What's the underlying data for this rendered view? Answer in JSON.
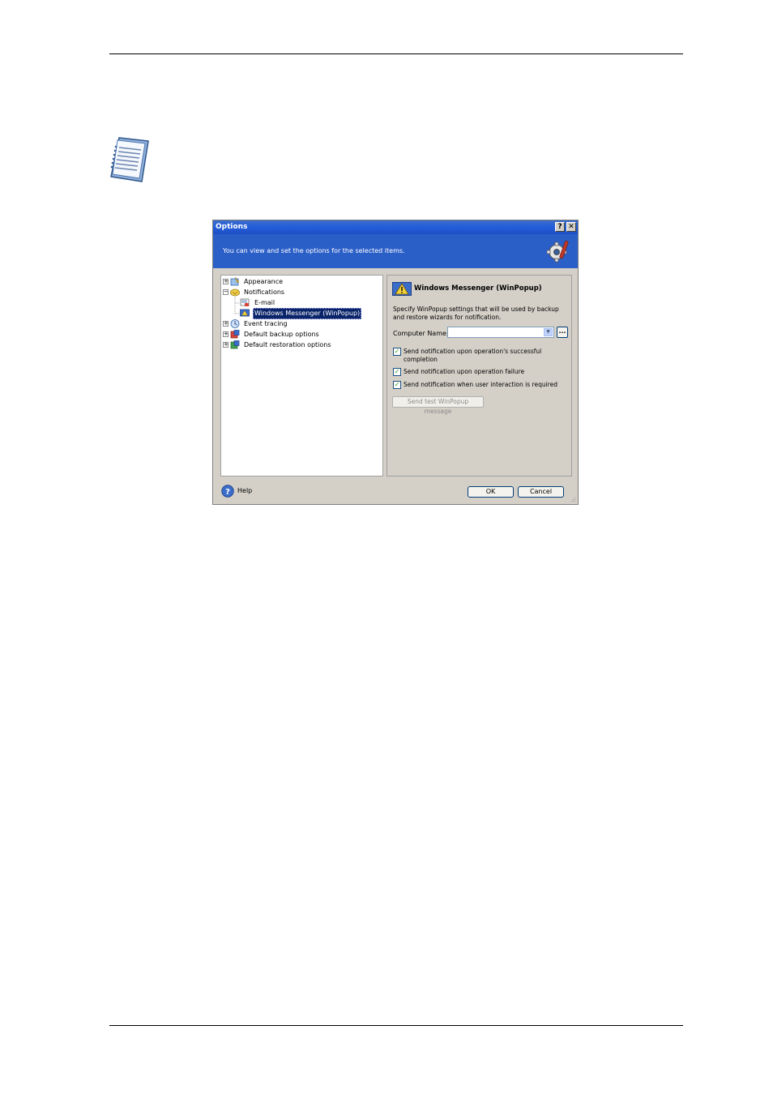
{
  "dialog": {
    "title": "Options",
    "help_glyph": "?",
    "close_glyph": "✕",
    "subtitle": "You can view and set the options for the selected items.",
    "banner_icon": "gear-wrench-icon"
  },
  "tree": {
    "items": [
      {
        "label": "Appearance",
        "expander": "+",
        "icon": "appearance-icon"
      },
      {
        "label": "Notifications",
        "expander": "−",
        "icon": "notifications-icon"
      },
      {
        "label": "E-mail",
        "icon": "email-icon"
      },
      {
        "label": "Windows Messenger (WinPopup)",
        "icon": "winpopup-icon",
        "selected": true
      },
      {
        "label": "Event tracing",
        "expander": "+",
        "icon": "event-tracing-icon"
      },
      {
        "label": "Default backup options",
        "expander": "+",
        "icon": "backup-options-icon"
      },
      {
        "label": "Default restoration options",
        "expander": "+",
        "icon": "restoration-options-icon"
      }
    ]
  },
  "panel": {
    "title": "Windows Messenger (WinPopup)",
    "title_icon": "winpopup-warning-icon",
    "description": "Specify WinPopup settings that will be used by backup and restore wizards for notification.",
    "computer_name_label": "Computer Name:",
    "computer_name_value": "",
    "browse_label": "...",
    "checkboxes": [
      {
        "label": "Send notification upon operation's successful completion",
        "checked": true
      },
      {
        "label": "Send notification upon operation failure",
        "checked": true
      },
      {
        "label": "Send notification when user interaction is required",
        "checked": true
      }
    ],
    "check_glyph": "✓",
    "test_button": "Send test WinPopup message"
  },
  "footer": {
    "help_label": "Help",
    "ok_label": "OK",
    "cancel_label": "Cancel"
  }
}
